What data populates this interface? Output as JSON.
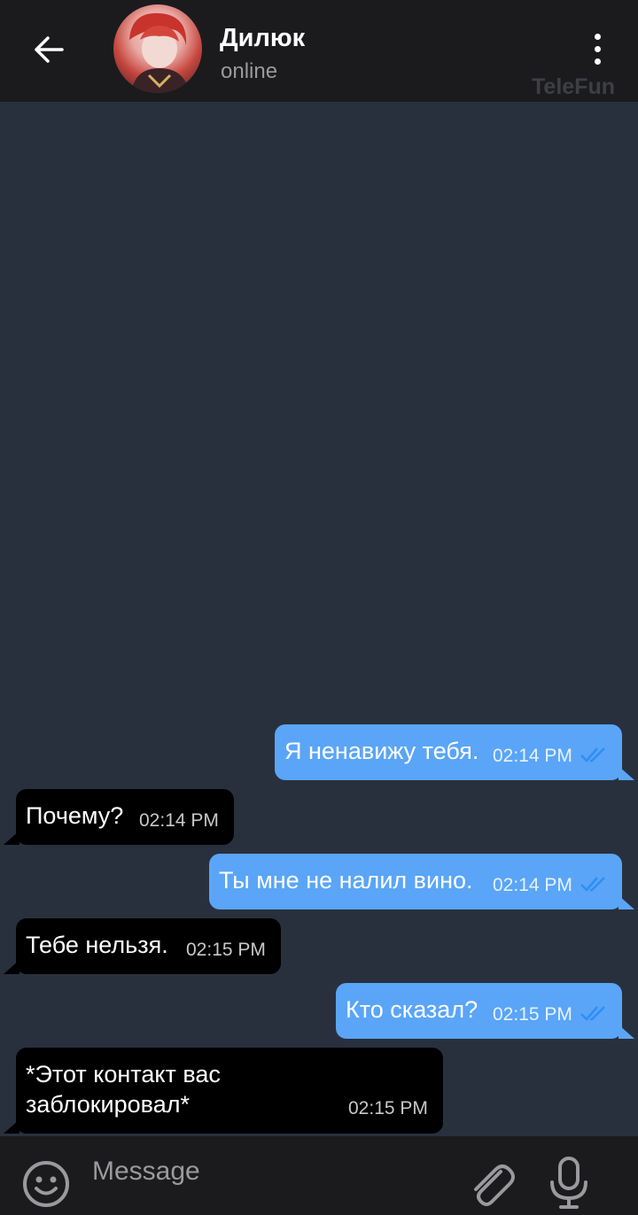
{
  "header": {
    "contact_name": "Дилюк",
    "status": "online",
    "watermark": "TeleFun",
    "icons": {
      "back": "arrow-left-icon",
      "menu": "kebab-menu-icon",
      "avatar": "contact-avatar"
    }
  },
  "messages": [
    {
      "direction": "outgoing",
      "text": "Я ненавижу тебя.",
      "time": "02:14 PM",
      "read": true
    },
    {
      "direction": "incoming",
      "text": "Почему?",
      "time": "02:14 PM"
    },
    {
      "direction": "outgoing",
      "text": "Ты мне не налил вино.",
      "time": "02:14 PM",
      "read": true
    },
    {
      "direction": "incoming",
      "text": "Тебе нельзя.",
      "time": "02:15 PM"
    },
    {
      "direction": "outgoing",
      "text": "Кто сказал?",
      "time": "02:15 PM",
      "read": true
    },
    {
      "direction": "incoming",
      "text_line1": "*Этот контакт вас",
      "text_line2": "заблокировал*",
      "time": "02:15 PM"
    }
  ],
  "input": {
    "placeholder": "Message",
    "value": "",
    "icons": {
      "emoji": "emoji-icon",
      "attach": "paperclip-icon",
      "mic": "microphone-icon"
    }
  },
  "colors": {
    "chat_background": "#29303d",
    "header_background": "#1b1b1d",
    "outgoing_bubble": "#5aa5f7",
    "incoming_bubble": "#000000",
    "read_ticks": "#2f8ef5"
  }
}
